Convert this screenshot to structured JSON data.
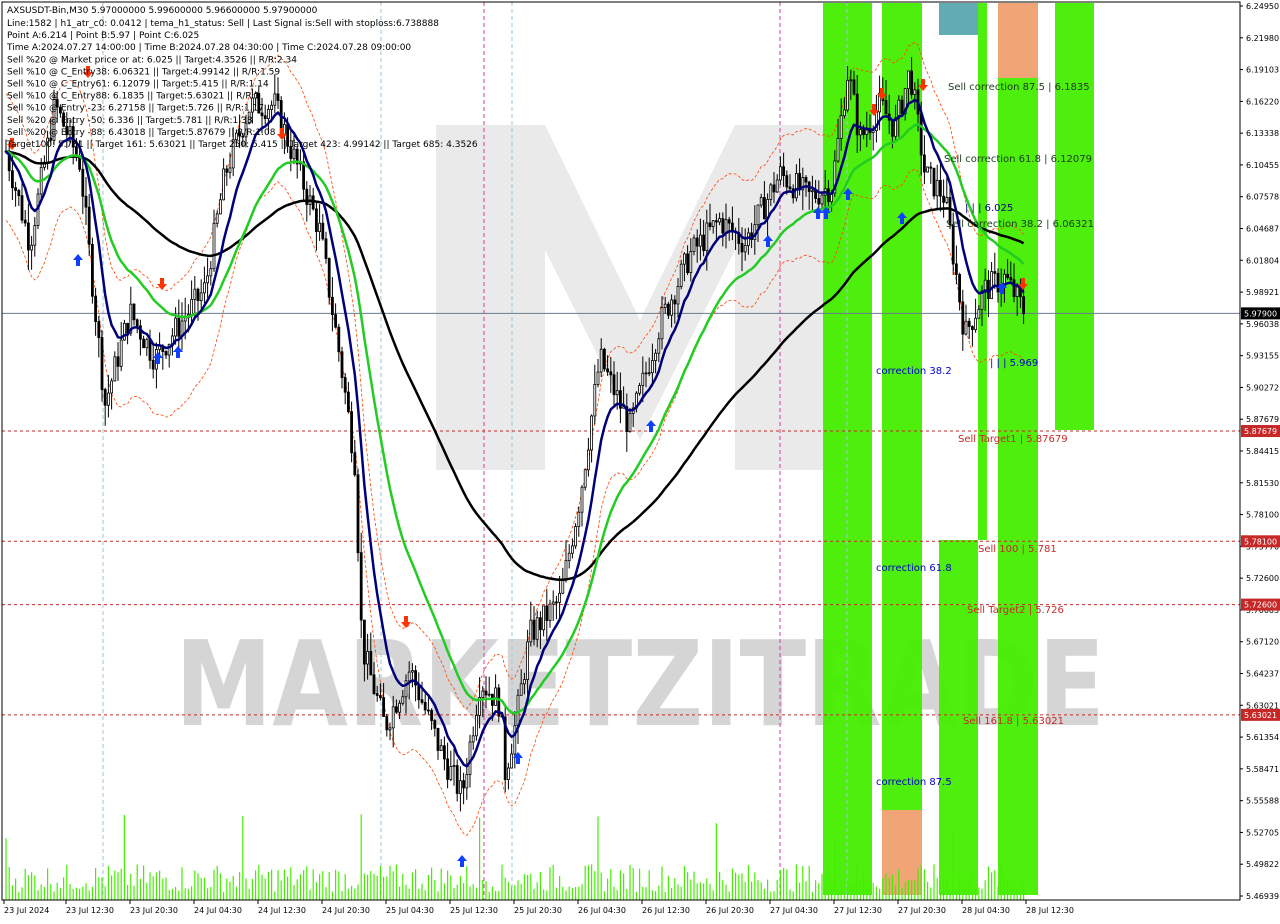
{
  "chart_data": {
    "type": "candlestick",
    "symbol_header": "AXSUSDT-Bin,M30  5.97000000 5.99600000 5.96600000 5.97900000",
    "info_lines": [
      "Line:1582 | h1_atr_c0: 0.0412 | tema_h1_status: Sell | Last Signal is:Sell with stoploss:6.738888",
      "Point A:6.214 | Point B:5.97 | Point C:6.025",
      "Time A:2024.07.27 14:00:00 | Time B:2024.07.28 04:30:00 | Time C:2024.07.28 09:00:00",
      "Sell %20 @ Market price or at: 6.025 || Target:4.3526 || R/R:2.34",
      "Sell %10 @ C_Entry38: 6.06321 || Target:4.99142 || R/R:1.59",
      "Sell %10 @ C_Entry61: 6.12079 || Target:5.415 || R/R:1.14",
      "Sell %10 @ C_Entry88: 6.1835 || Target:5.63021 || R/R:1",
      "Sell %10 @ Entry -23: 6.27158 || Target:5.726 || R/R:1.17",
      "Sell %20 @ Entry -50: 6.336 || Target:5.781 || R/R:1.38",
      "Sell %20 @ Entry -88: 6.43018 || Target:5.87679 || R/R:1.08",
      "Target100: 5.781 || Target 161: 5.63021 || Target 250: 5.415 || Target 423: 4.99142 || Target 685: 4.3526"
    ],
    "y_axis_ticks": [
      "6.24950",
      "6.21980",
      "6.19103",
      "6.16220",
      "6.13338",
      "6.10455",
      "6.07578",
      "6.04687",
      "6.01804",
      "5.98921",
      "5.96038",
      "5.93155",
      "5.90272",
      "5.87679",
      "5.84415",
      "5.81530",
      "5.78100",
      "5.75770",
      "5.72600",
      "5.70003",
      "5.67120",
      "5.64237",
      "5.63021",
      "5.61354",
      "5.58471",
      "5.55588",
      "5.52705",
      "5.49822",
      "5.46939"
    ],
    "highlighted_levels": [
      {
        "price": 5.979,
        "label": "5.97900",
        "color": "#000000"
      },
      {
        "price": 5.87679,
        "label": "5.87679",
        "color": "#c62828"
      },
      {
        "price": 5.781,
        "label": "5.78100",
        "color": "#c62828"
      },
      {
        "price": 5.726,
        "label": "5.72600",
        "color": "#c62828"
      },
      {
        "price": 5.63021,
        "label": "5.63021",
        "color": "#c62828"
      }
    ],
    "x_axis_labels": [
      "23 Jul 2024",
      "23 Jul 12:30",
      "23 Jul 20:30",
      "24 Jul 04:30",
      "24 Jul 12:30",
      "24 Jul 20:30",
      "25 Jul 04:30",
      "25 Jul 12:30",
      "25 Jul 20:30",
      "26 Jul 04:30",
      "26 Jul 12:30",
      "26 Jul 20:30",
      "27 Jul 04:30",
      "27 Jul 12:30",
      "27 Jul 20:30",
      "28 Jul 04:30",
      "28 Jul 12:30"
    ],
    "zone_labels": [
      {
        "text": "Sell correction 87.5 | 6.1835",
        "color": "#1a3a1a"
      },
      {
        "text": "Sell correction 61.8 | 6.12079",
        "color": "#1a3a1a"
      },
      {
        "text": "Sell correction 38.2 | 6.06321",
        "color": "#1a3a1a"
      },
      {
        "text": "| | | 6.025",
        "color": "#000080"
      },
      {
        "text": "| | | 5.969",
        "color": "#0000cc"
      },
      {
        "text": "correction 38.2",
        "color": "#0000cc"
      },
      {
        "text": "correction 61.8",
        "color": "#0000cc"
      },
      {
        "text": "correction 87.5",
        "color": "#0000cc"
      },
      {
        "text": "Sell Target1 | 5.87679",
        "color": "#c62828"
      },
      {
        "text": "Sell 100 | 5.781",
        "color": "#c62828"
      },
      {
        "text": "Sell Target2 | 5.726",
        "color": "#c62828"
      },
      {
        "text": "Sell 161.8 | 5.63021",
        "color": "#c62828"
      }
    ],
    "watermark": "MARKETZITRADE",
    "colors": {
      "bull_candle": "#000000",
      "bear_candle": "#000000",
      "ma_fast": "#00007a",
      "ma_mid": "#22cc22",
      "ma_slow": "#000000",
      "band": "#ff4400",
      "zone_green": "#44ee00",
      "zone_orange": "#f0a070",
      "zone_teal": "#5aa7b0",
      "target_line": "#c62828",
      "buy_arrow": "#1040ff",
      "sell_arrow": "#ff3300"
    }
  }
}
